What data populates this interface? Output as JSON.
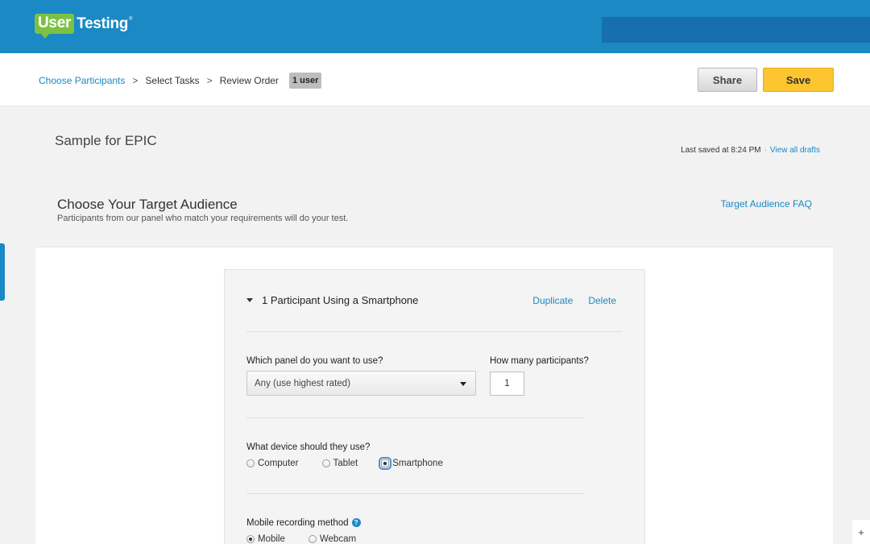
{
  "header": {
    "logo_user": "User",
    "logo_testing": "Testing",
    "logo_tm": "®"
  },
  "breadcrumb": {
    "items": [
      "Choose Participants",
      "Select Tasks",
      "Review Order"
    ],
    "separator": ">",
    "badge": "1 user"
  },
  "toolbar": {
    "share_label": "Share",
    "save_label": "Save"
  },
  "document": {
    "title": "Sample for EPIC",
    "last_saved": "Last saved at 8:24 PM",
    "separator": "·",
    "view_drafts": "View all drafts"
  },
  "panel": {
    "title": "Choose Your Target Audience",
    "subtitle": "Participants from our panel who match your requirements will do your test.",
    "faq_link": "Target Audience FAQ"
  },
  "group": {
    "title": "1 Participant Using a Smartphone",
    "duplicate": "Duplicate",
    "delete": "Delete",
    "panel_question": "Which panel do you want to use?",
    "panel_value": "Any (use highest rated)",
    "count_question": "How many participants?",
    "count_value": "1",
    "device_question": "What device should they use?",
    "device_options": [
      "Computer",
      "Tablet",
      "Smartphone"
    ],
    "device_selected": "Smartphone",
    "recording_question": "Mobile recording method",
    "help_icon": "?",
    "recording_options": [
      "Mobile",
      "Webcam"
    ],
    "recording_selected": "Mobile"
  },
  "corner": {
    "plus": "+"
  },
  "colors": {
    "brand_blue": "#1a89c4",
    "logo_green": "#7cc142",
    "save_yellow": "#fdc630"
  }
}
